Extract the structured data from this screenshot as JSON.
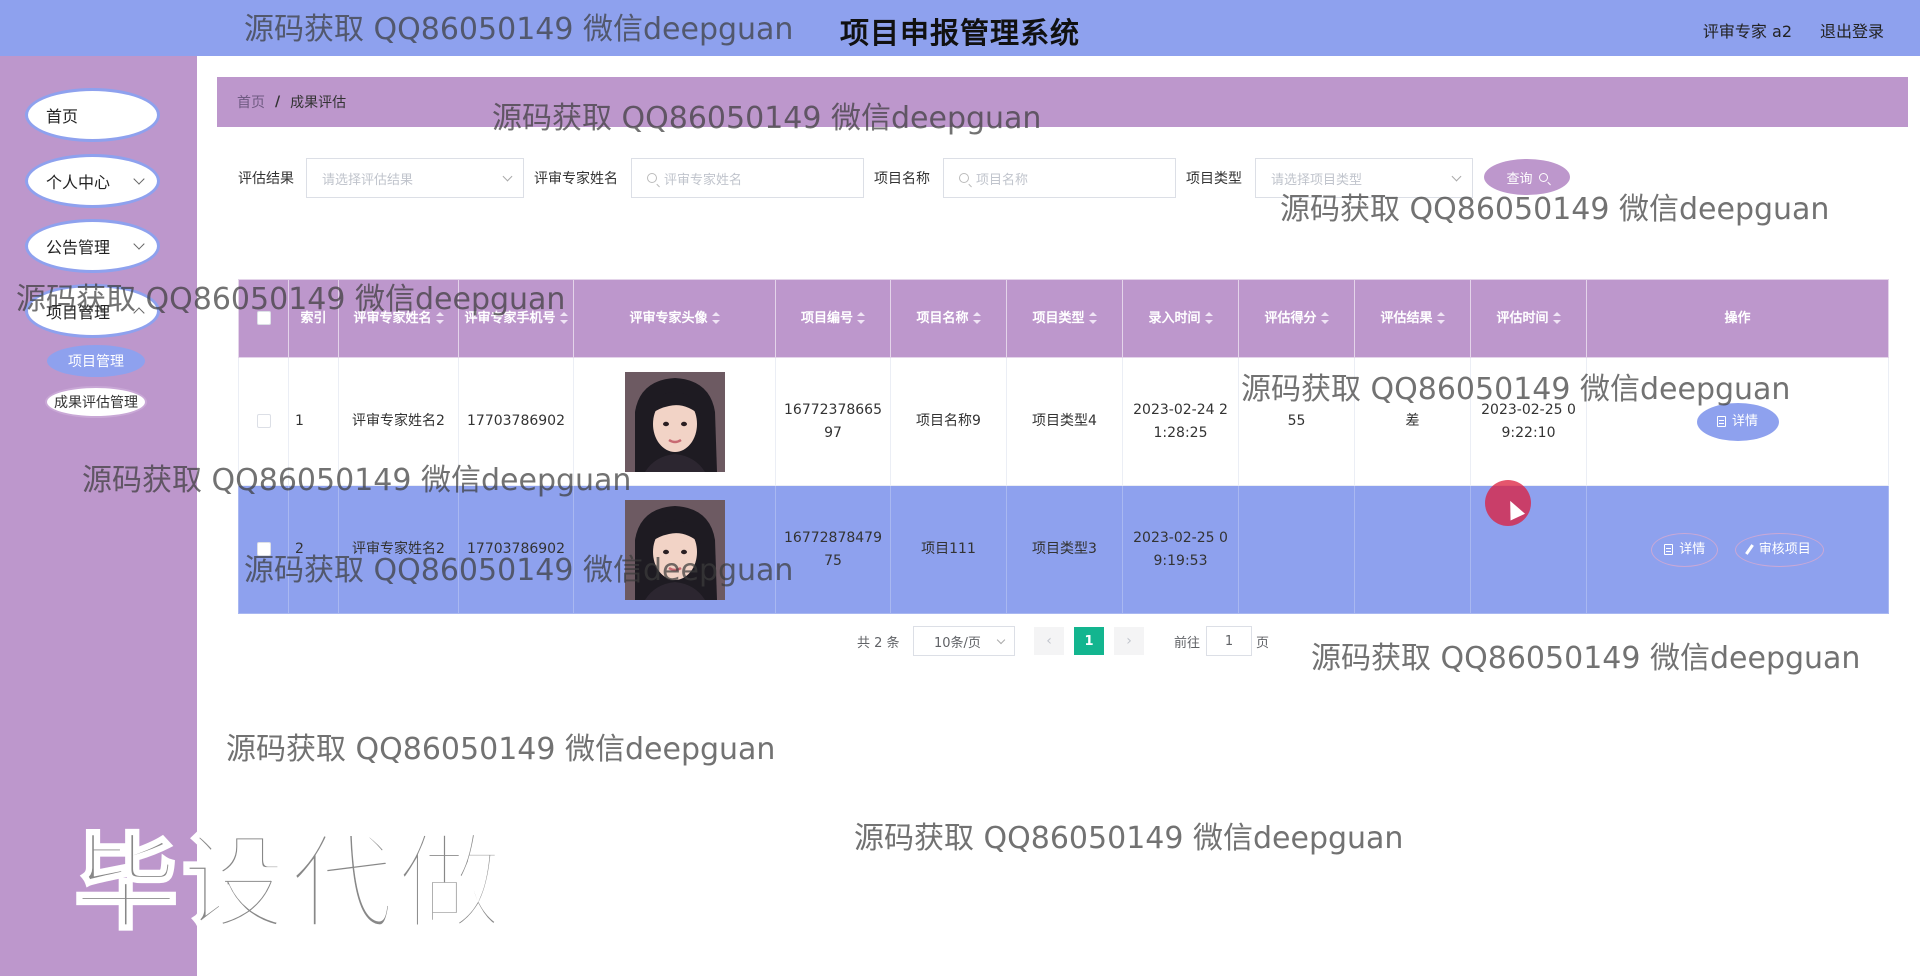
{
  "header": {
    "title": "项目申报管理系统",
    "user": "评审专家 a2",
    "logout": "退出登录"
  },
  "sidebar": {
    "items": [
      {
        "label": "首页"
      },
      {
        "label": "个人中心"
      },
      {
        "label": "公告管理"
      },
      {
        "label": "项目管理"
      }
    ],
    "subitems": [
      {
        "label": "项目管理"
      },
      {
        "label": "成果评估管理"
      }
    ]
  },
  "breadcrumb": {
    "home": "首页",
    "sep": "/",
    "current": "成果评估"
  },
  "filters": {
    "result_label": "评估结果",
    "result_placeholder": "请选择评估结果",
    "expert_label": "评审专家姓名",
    "expert_placeholder": "评审专家姓名",
    "project_label": "项目名称",
    "project_placeholder": "项目名称",
    "type_label": "项目类型",
    "type_placeholder": "请选择项目类型",
    "query_label": "查询"
  },
  "table": {
    "headers": [
      "索引",
      "评审专家姓名",
      "评审专家手机号",
      "评审专家头像",
      "项目编号",
      "项目名称",
      "项目类型",
      "录入时间",
      "评估得分",
      "评估结果",
      "评估时间",
      "操作"
    ],
    "rows": [
      {
        "index": "1",
        "name": "评审专家姓名2",
        "phone": "17703786902",
        "code": "1677237866597",
        "project": "项目名称9",
        "type": "项目类型4",
        "entry": "2023-02-24 21:28:25",
        "score": "55",
        "result": "差",
        "eval_time": "2023-02-25 09:22:10",
        "detail": "详情"
      },
      {
        "index": "2",
        "name": "评审专家姓名2",
        "phone": "17703786902",
        "code": "1677287847975",
        "project": "项目111",
        "type": "项目类型3",
        "entry": "2023-02-25 09:19:53",
        "score": "",
        "result": "",
        "eval_time": "",
        "detail": "详情",
        "review": "审核项目"
      }
    ]
  },
  "pagination": {
    "total": "共 2 条",
    "page_size": "10条/页",
    "prev": "‹",
    "page": "1",
    "next": "›",
    "goto": "前往",
    "goto_value": "1",
    "unit": "页"
  },
  "watermarks": {
    "text": "源码获取 QQ86050149 微信deepguan",
    "big": "毕设代做"
  }
}
